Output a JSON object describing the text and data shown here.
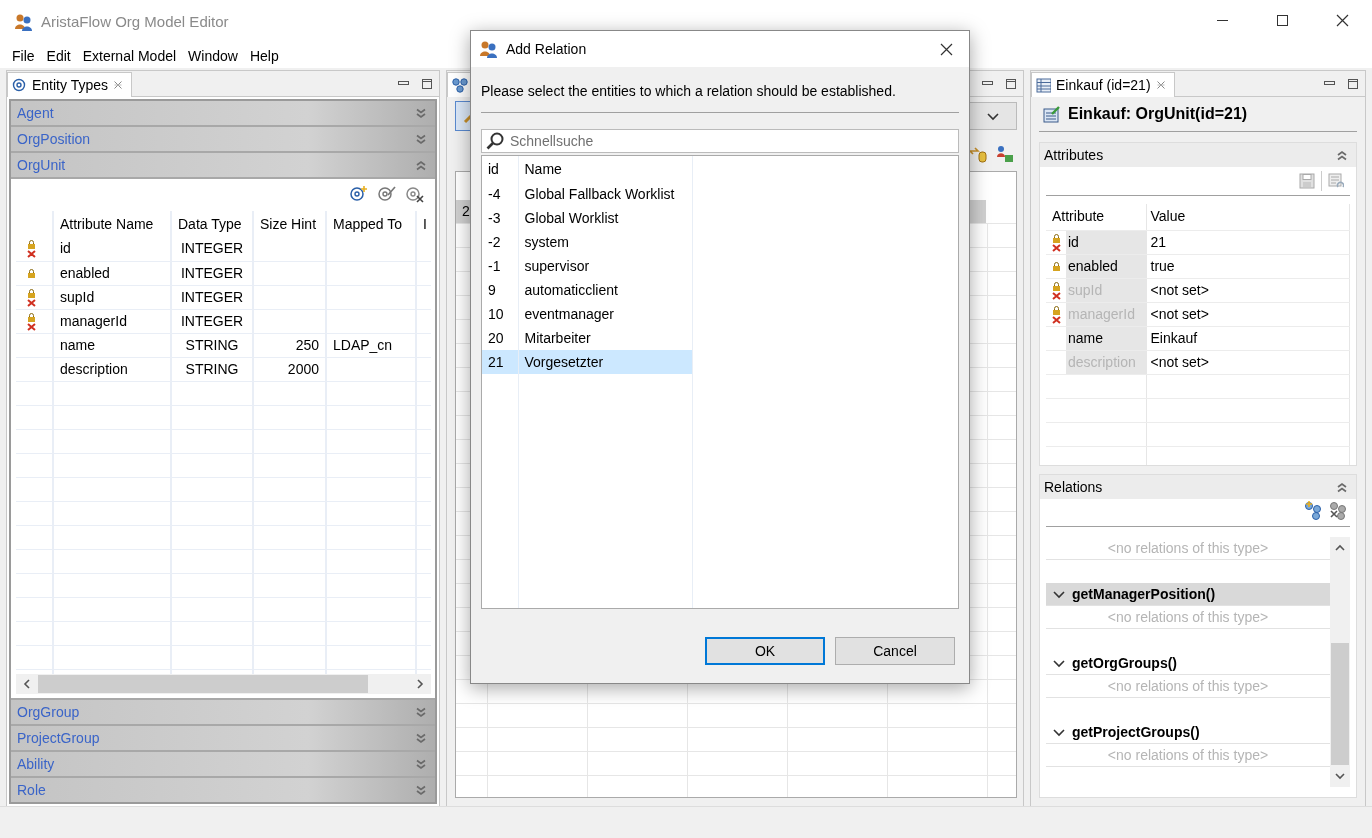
{
  "window": {
    "title": "AristaFlow Org Model Editor"
  },
  "menu": [
    {
      "label": "File"
    },
    {
      "label": "Edit"
    },
    {
      "label": "External Model"
    },
    {
      "label": "Window"
    },
    {
      "label": "Help"
    }
  ],
  "entity_types": {
    "tab": "Entity Types",
    "sections": [
      {
        "label": "Agent",
        "expanded": false
      },
      {
        "label": "OrgPosition",
        "expanded": false
      },
      {
        "label": "OrgUnit",
        "expanded": true,
        "table": {
          "columns": [
            "Attribute Name",
            "Data Type",
            "Size Hint",
            "Mapped To",
            "I"
          ],
          "rows": [
            {
              "kind": "lock-cross",
              "name": "id",
              "data_type": "INTEGER"
            },
            {
              "kind": "lock",
              "name": "enabled",
              "data_type": "INTEGER"
            },
            {
              "kind": "lock-cross",
              "name": "supId",
              "data_type": "INTEGER"
            },
            {
              "kind": "lock-cross",
              "name": "managerId",
              "data_type": "INTEGER"
            },
            {
              "kind": "plain",
              "name": "name",
              "data_type": "STRING",
              "size_hint": "250",
              "mapped_to": "LDAP_cn"
            },
            {
              "kind": "plain",
              "name": "description",
              "data_type": "STRING",
              "size_hint": "2000"
            }
          ]
        }
      },
      {
        "label": "OrgGroup",
        "expanded": false
      },
      {
        "label": "ProjectGroup",
        "expanded": false
      },
      {
        "label": "Ability",
        "expanded": false
      },
      {
        "label": "Role",
        "expanded": false
      }
    ]
  },
  "editor": {
    "row_text": "2"
  },
  "dialog": {
    "title": "Add Relation",
    "message": "Please select the entities to which a relation should be established.",
    "search": {
      "placeholder": "Schnellsuche"
    },
    "columns": [
      "id",
      "Name"
    ],
    "rows": [
      {
        "id": "-4",
        "name": "Global Fallback Worklist",
        "selected": false
      },
      {
        "id": "-3",
        "name": "Global Worklist",
        "selected": false
      },
      {
        "id": "-2",
        "name": "system",
        "selected": false
      },
      {
        "id": "-1",
        "name": "supervisor",
        "selected": false
      },
      {
        "id": "9",
        "name": "automaticclient",
        "selected": false
      },
      {
        "id": "10",
        "name": "eventmanager",
        "selected": false
      },
      {
        "id": "20",
        "name": "Mitarbeiter",
        "selected": false
      },
      {
        "id": "21",
        "name": "Vorgesetzter",
        "selected": true
      }
    ],
    "buttons": [
      {
        "label": "OK",
        "default": true
      },
      {
        "label": "Cancel",
        "default": false
      }
    ]
  },
  "details": {
    "tab": "Einkauf (id=21)",
    "heading": "Einkauf: OrgUnit(id=21)",
    "attributes": {
      "title": "Attributes",
      "expanded": true,
      "columns": [
        "Attribute",
        "Value"
      ],
      "rows": [
        {
          "kind": "lock-cross",
          "name": "id",
          "value": "21",
          "disabled": false
        },
        {
          "kind": "lock",
          "name": "enabled",
          "value": "true",
          "disabled": false
        },
        {
          "kind": "lock-cross",
          "name": "supId",
          "value": "<not set>",
          "disabled": true
        },
        {
          "kind": "lock-cross",
          "name": "managerId",
          "value": "<not set>",
          "disabled": true
        },
        {
          "kind": "plain",
          "name": "name",
          "value": "Einkauf",
          "disabled": false
        },
        {
          "kind": "plain",
          "name": "description",
          "value": "<not set>",
          "disabled": true
        }
      ]
    },
    "relations": {
      "title": "Relations",
      "expanded": true,
      "groups": [
        {
          "empty_text": "<no relations of this type>"
        },
        {
          "name": "getManagerPosition()",
          "expanded": true,
          "selected": true,
          "empty_text": "<no relations of this type>"
        },
        {
          "name": "getOrgGroups()",
          "expanded": true,
          "selected": false,
          "empty_text": "<no relations of this type>"
        },
        {
          "name": "getProjectGroups()",
          "expanded": true,
          "selected": false,
          "empty_text": "<no relations of this type>"
        }
      ]
    }
  }
}
